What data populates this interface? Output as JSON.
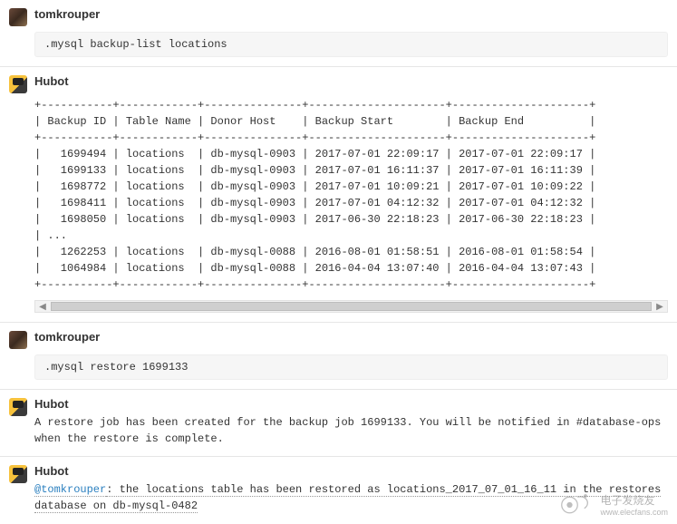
{
  "messages": [
    {
      "user": "tomkrouper",
      "avatar": "tom",
      "type": "command",
      "text": ".mysql backup-list locations"
    },
    {
      "user": "Hubot",
      "avatar": "hubot",
      "type": "ascii_table"
    },
    {
      "user": "tomkrouper",
      "avatar": "tom",
      "type": "command",
      "text": ".mysql restore 1699133"
    },
    {
      "user": "Hubot",
      "avatar": "hubot",
      "type": "mono",
      "text": "A restore job has been created for the backup job 1699133. You will be notified in #database-ops when the restore is complete."
    },
    {
      "user": "Hubot",
      "avatar": "hubot",
      "type": "mono_mention",
      "mention": "@tomkrouper",
      "rest": ": the locations table has been restored as locations_2017_07_01_16_11 in the restores database on db-mysql-0482"
    }
  ],
  "ascii_table": {
    "columns": [
      "Backup ID",
      "Table Name",
      "Donor Host",
      "Backup Start",
      "Backup End"
    ],
    "rows": [
      [
        "1699494",
        "locations",
        "db-mysql-0903",
        "2017-07-01 22:09:17",
        "2017-07-01 22:09:17"
      ],
      [
        "1699133",
        "locations",
        "db-mysql-0903",
        "2017-07-01 16:11:37",
        "2017-07-01 16:11:39"
      ],
      [
        "1698772",
        "locations",
        "db-mysql-0903",
        "2017-07-01 10:09:21",
        "2017-07-01 10:09:22"
      ],
      [
        "1698411",
        "locations",
        "db-mysql-0903",
        "2017-07-01 04:12:32",
        "2017-07-01 04:12:32"
      ],
      [
        "1698050",
        "locations",
        "db-mysql-0903",
        "2017-06-30 22:18:23",
        "2017-06-30 22:18:23"
      ]
    ],
    "ellipsis": "...",
    "tail_rows": [
      [
        "1262253",
        "locations",
        "db-mysql-0088",
        "2016-08-01 01:58:51",
        "2016-08-01 01:58:54"
      ],
      [
        "1064984",
        "locations",
        "db-mysql-0088",
        "2016-04-04 13:07:40",
        "2016-04-04 13:07:43"
      ]
    ]
  },
  "scrollbar": {
    "left_glyph": "◀",
    "right_glyph": "▶"
  },
  "watermark": {
    "text": "电子发烧友",
    "url_hint": "www.elecfans.com"
  }
}
